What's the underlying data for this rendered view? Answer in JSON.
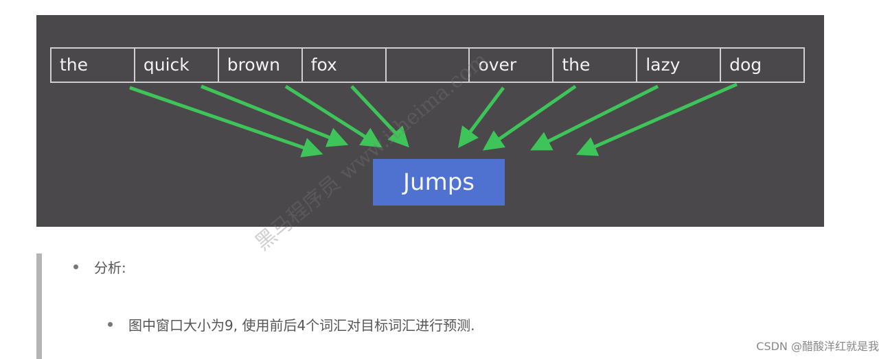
{
  "figure": {
    "context_words": [
      "the",
      "quick",
      "brown",
      "fox",
      "",
      "over",
      "the",
      "lazy",
      "dog"
    ],
    "target_word": "Jumps",
    "colors": {
      "background": "#4a484b",
      "arrow": "#3fc45a",
      "target_box": "#4f72d0",
      "cell_border": "#d0d0d0"
    }
  },
  "watermark": "黑马程序员 www.itheima.com",
  "notes": {
    "heading": "分析:",
    "detail": "图中窗口大小为9, 使用前后4个词汇对目标词汇进行预测."
  },
  "credit": "CSDN @醋酸洋红就是我"
}
